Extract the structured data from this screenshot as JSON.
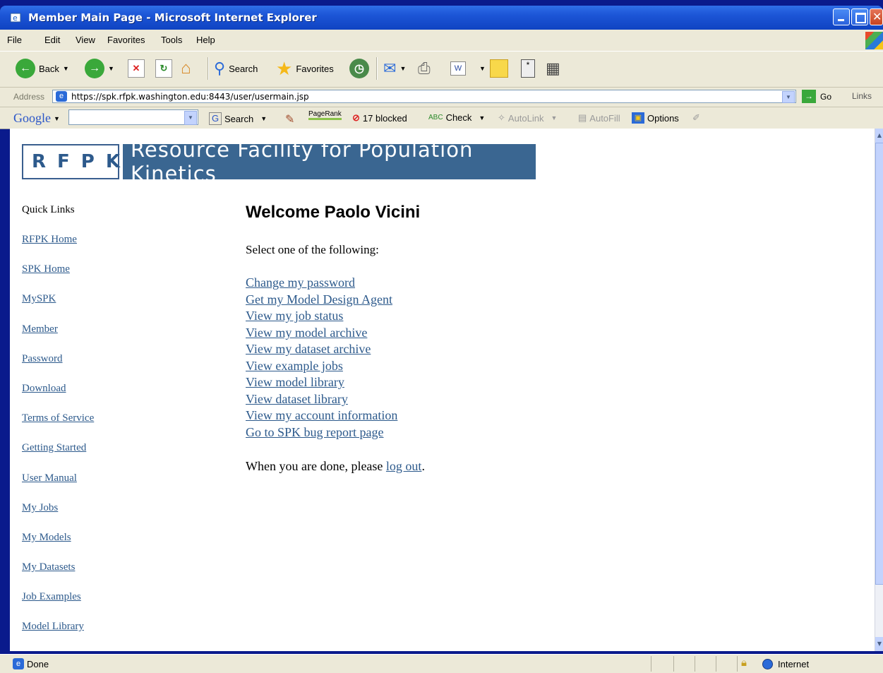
{
  "window": {
    "title": "Member Main Page - Microsoft Internet Explorer"
  },
  "menu": [
    "File",
    "Edit",
    "View",
    "Favorites",
    "Tools",
    "Help"
  ],
  "toolbar": {
    "back": "Back",
    "search": "Search",
    "favorites": "Favorites"
  },
  "address": {
    "label": "Address",
    "url": "https://spk.rfpk.washington.edu:8443/user/usermain.jsp",
    "go": "Go",
    "links": "Links"
  },
  "google": {
    "logo": "Google",
    "search": "Search",
    "pagerank": "PageRank",
    "blocked": "17 blocked",
    "check": "Check",
    "autolink": "AutoLink",
    "autofill": "AutoFill",
    "options": "Options"
  },
  "banner": {
    "abbrev": "RFPK",
    "title": "Resource Facility for Population Kinetics"
  },
  "sidebar": {
    "title": "Quick Links",
    "links": [
      "RFPK Home",
      "SPK Home",
      "MySPK",
      "Member",
      "Password",
      "Download",
      "Terms of Service",
      "Getting Started",
      "User Manual",
      "My Jobs",
      "My Models",
      "My Datasets",
      "Job Examples",
      "Model Library"
    ]
  },
  "main": {
    "welcome": "Welcome Paolo Vicini",
    "prompt": "Select one of the following:",
    "links": [
      "Change my password",
      "Get my Model Design Agent",
      "View my job status",
      "View my model archive",
      "View my dataset archive",
      "View example jobs",
      "View model library",
      "View dataset library",
      "View my account information",
      "Go to SPK bug report page"
    ],
    "done_prefix": "When you are done, please ",
    "logout": "log out",
    "done_suffix": "."
  },
  "status": {
    "text": "Done",
    "zone": "Internet"
  }
}
